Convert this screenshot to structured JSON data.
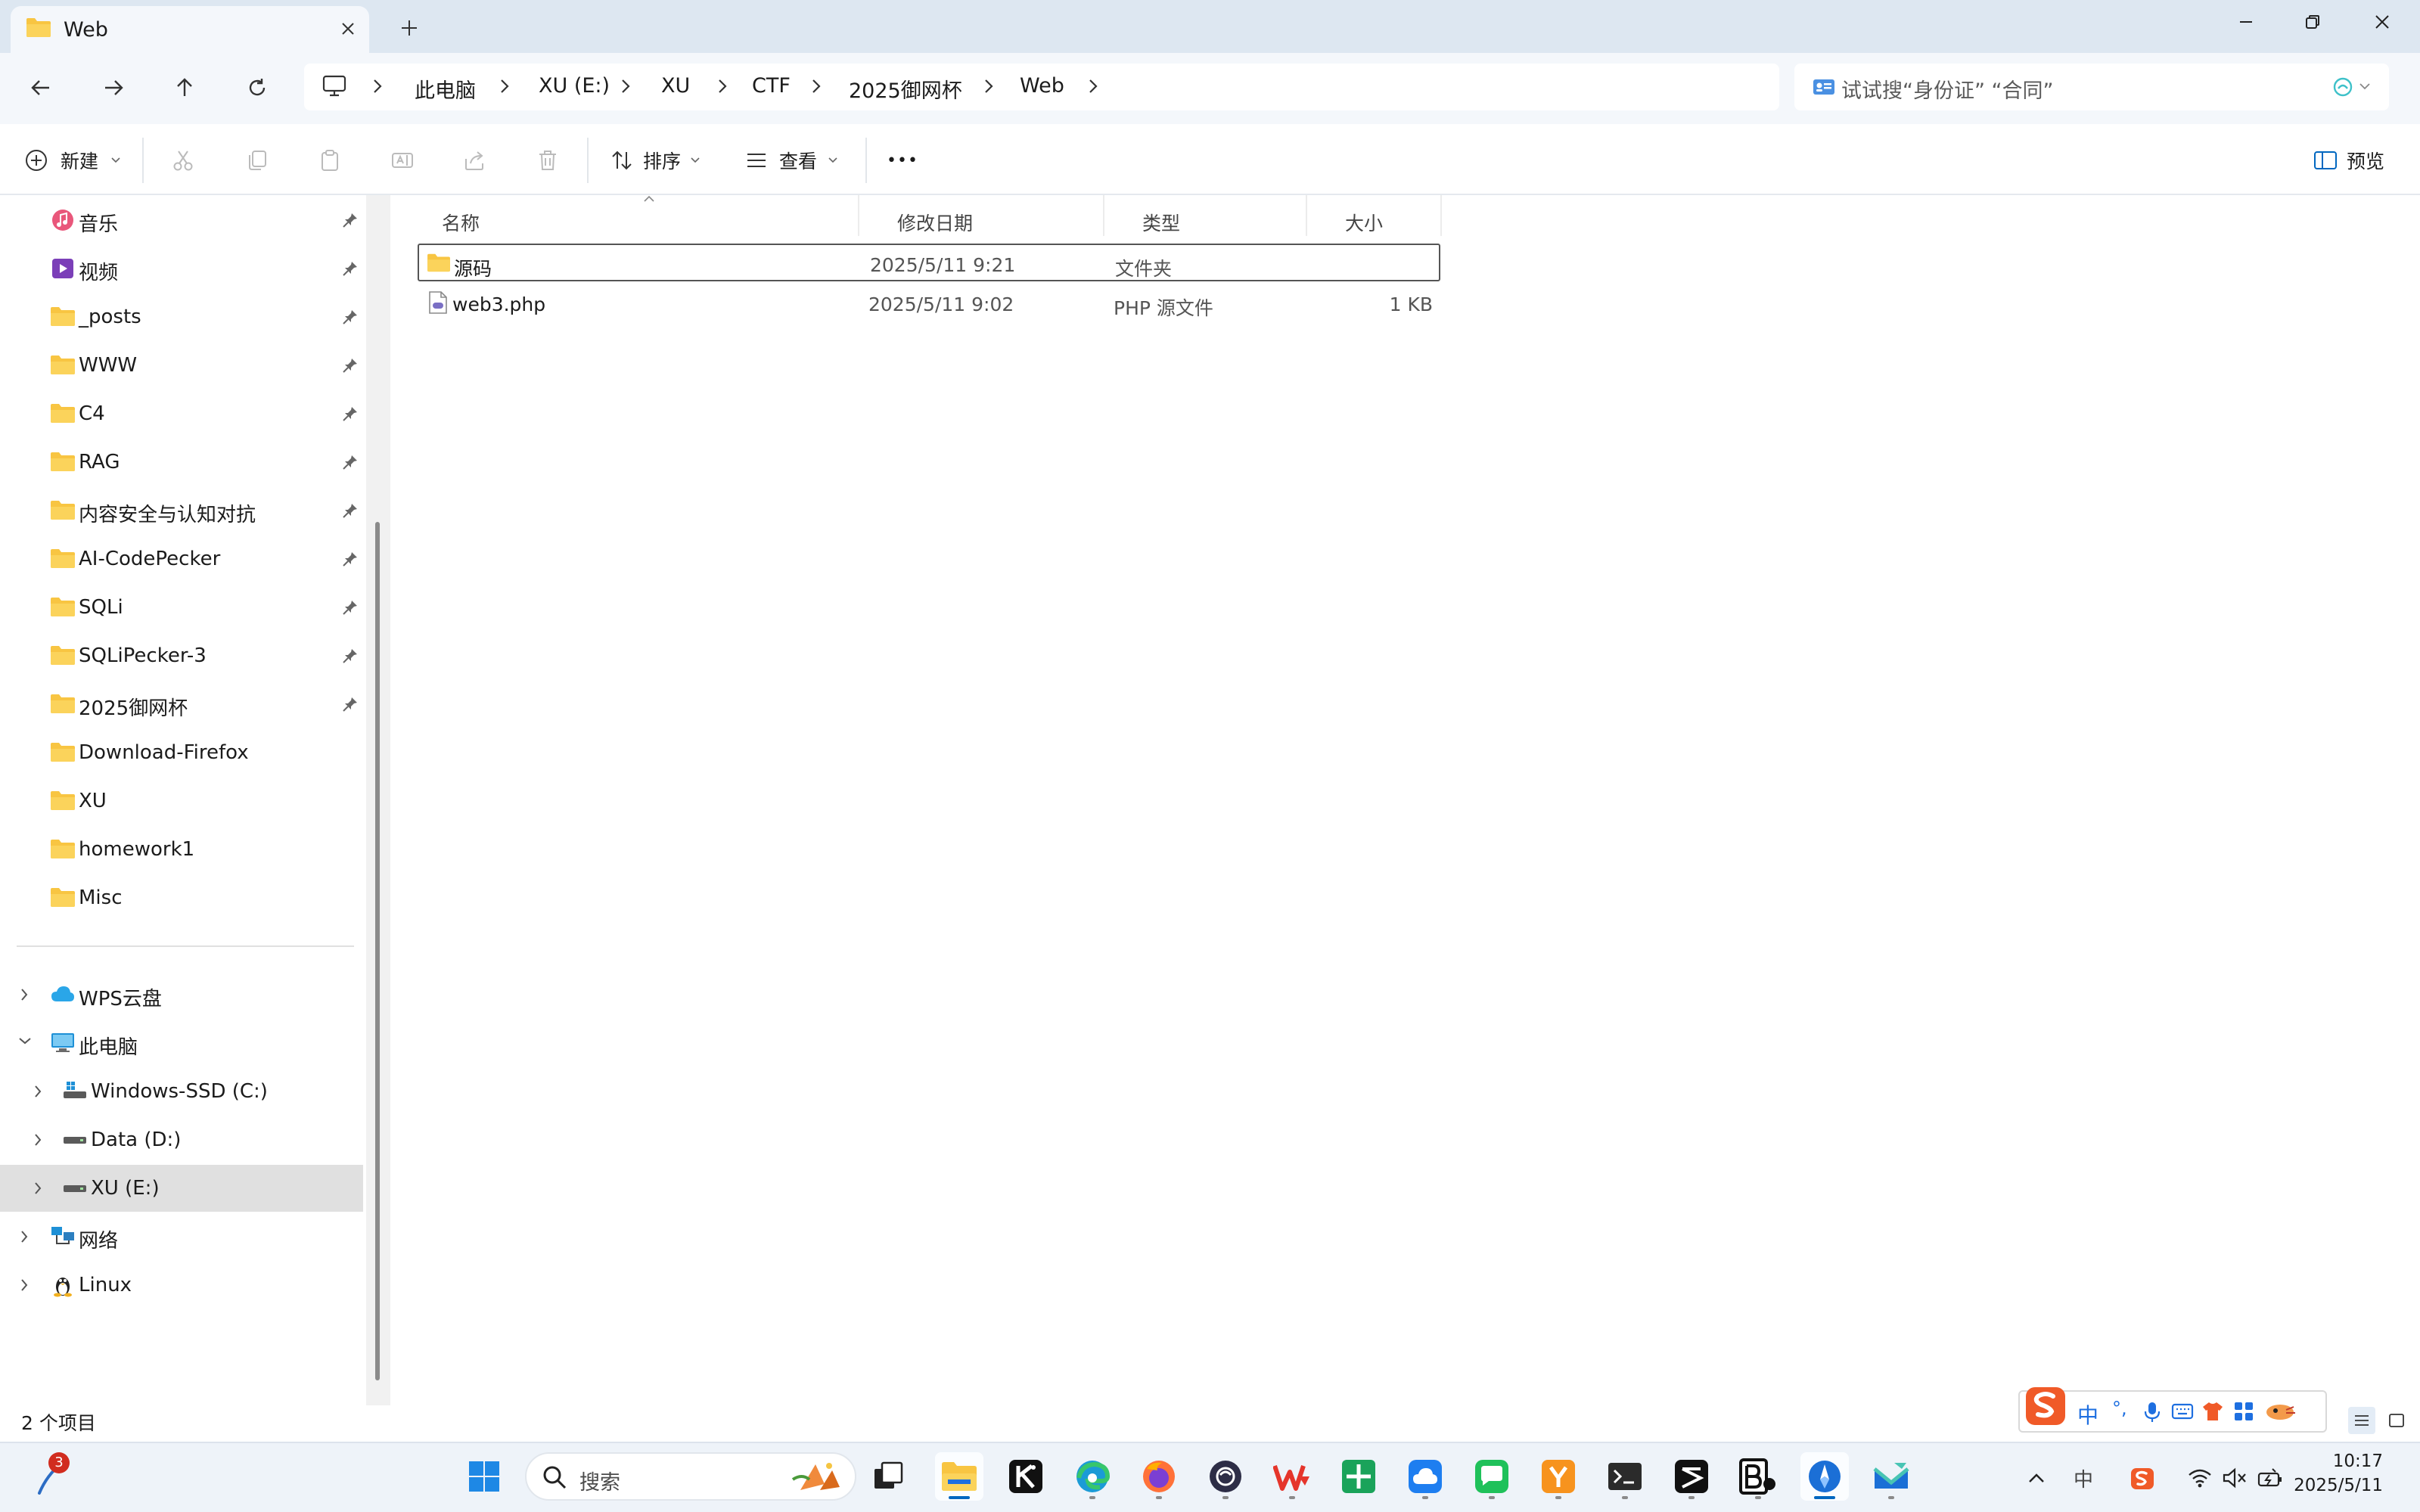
{
  "window": {
    "tab_title": "Web",
    "new_tab_label": "+"
  },
  "address": {
    "crumbs": [
      "此电脑",
      "XU (E:)",
      "XU",
      "CTF",
      "2025御网杯",
      "Web"
    ]
  },
  "search": {
    "placeholder": "试试搜“身份证”  “合同”"
  },
  "toolbar": {
    "new_label": "新建",
    "sort_label": "排序",
    "view_label": "查看",
    "more_label": "•••",
    "preview_label": "预览"
  },
  "nav": {
    "quick_access": [
      {
        "label": "音乐",
        "icon": "music-icon",
        "pinned": true
      },
      {
        "label": "视频",
        "icon": "video-icon",
        "pinned": true
      },
      {
        "label": "_posts",
        "icon": "folder-icon",
        "pinned": true
      },
      {
        "label": "WWW",
        "icon": "folder-icon",
        "pinned": true
      },
      {
        "label": "C4",
        "icon": "folder-icon",
        "pinned": true
      },
      {
        "label": "RAG",
        "icon": "folder-icon",
        "pinned": true
      },
      {
        "label": "内容安全与认知对抗",
        "icon": "folder-icon",
        "pinned": true
      },
      {
        "label": "AI-CodePecker",
        "icon": "folder-icon",
        "pinned": true
      },
      {
        "label": "SQLi",
        "icon": "folder-icon",
        "pinned": true
      },
      {
        "label": "SQLiPecker-3",
        "icon": "folder-icon",
        "pinned": true
      },
      {
        "label": "2025御网杯",
        "icon": "folder-icon",
        "pinned": true
      },
      {
        "label": "Download-Firefox",
        "icon": "folder-icon",
        "pinned": false
      },
      {
        "label": "XU",
        "icon": "folder-icon",
        "pinned": false
      },
      {
        "label": "homework1",
        "icon": "folder-icon",
        "pinned": false
      },
      {
        "label": "Misc",
        "icon": "folder-icon",
        "pinned": false
      }
    ],
    "tree": [
      {
        "label": "WPS云盘",
        "icon": "cloud-icon",
        "expanded": false
      },
      {
        "label": "此电脑",
        "icon": "computer-icon",
        "expanded": true
      },
      {
        "label": "Windows-SSD (C:)",
        "icon": "windows-drive-icon",
        "expanded": false
      },
      {
        "label": "Data (D:)",
        "icon": "drive-icon",
        "expanded": false
      },
      {
        "label": "XU (E:)",
        "icon": "drive-icon",
        "expanded": false,
        "selected": true
      },
      {
        "label": "网络",
        "icon": "network-icon",
        "expanded": false
      },
      {
        "label": "Linux",
        "icon": "linux-icon",
        "expanded": false
      }
    ]
  },
  "files": {
    "columns": [
      "名称",
      "修改日期",
      "类型",
      "大小"
    ],
    "rows": [
      {
        "name": "源码",
        "modified": "2025/5/11 9:21",
        "type": "文件夹",
        "size": "",
        "icon": "folder-icon"
      },
      {
        "name": "web3.php",
        "modified": "2025/5/11 9:02",
        "type": "PHP 源文件",
        "size": "1 KB",
        "icon": "php-file-icon"
      }
    ]
  },
  "status": {
    "item_count": "2 个项目"
  },
  "ime": {
    "mode_label": "中",
    "punct_label": "°,"
  },
  "taskbar": {
    "search_placeholder": "搜索",
    "notification_count": "3",
    "tray_ime_label": "中",
    "clock_time": "10:17",
    "clock_date": "2025/5/11"
  },
  "colors": {
    "folder": "#f8c542",
    "accent": "#0067c0",
    "selected_bg": "#e0e0e0",
    "titlebar_bg": "#dde7f1"
  }
}
